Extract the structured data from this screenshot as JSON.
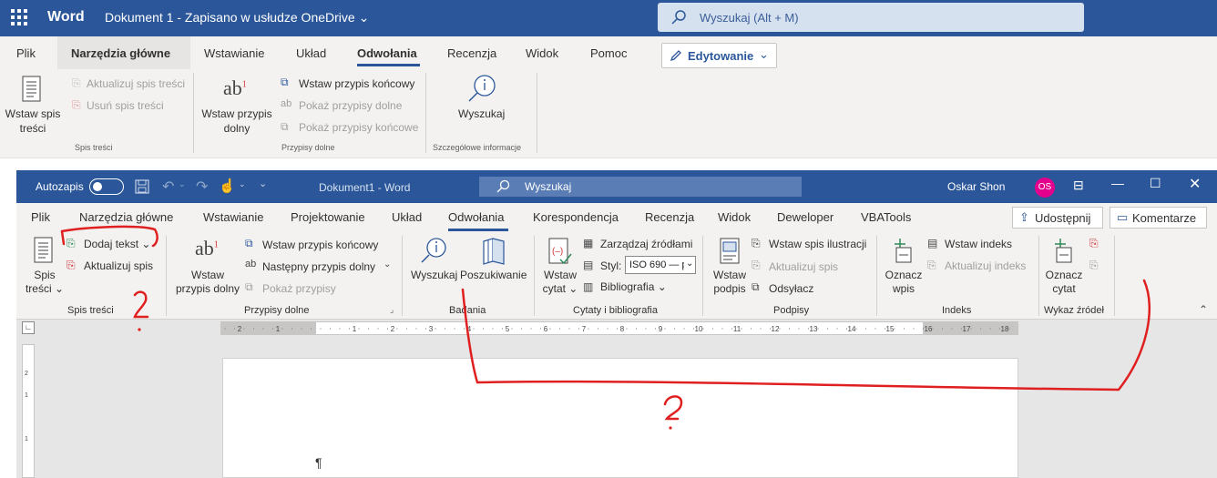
{
  "web": {
    "app_name": "Word",
    "doc_title": "Dokument 1 - Zapisano w usłudze OneDrive",
    "search_placeholder": "Wyszukaj (Alt + M)",
    "tabs": [
      "Plik",
      "Narzędzia główne",
      "Wstawianie",
      "Układ",
      "Odwołania",
      "Recenzja",
      "Widok",
      "Pomoc"
    ],
    "active_tab": "Odwołania",
    "edit_mode": "Edytowanie",
    "ribbon": {
      "toc_group": {
        "title": "Spis treści",
        "insert_toc_line1": "Wstaw spis",
        "insert_toc_line2": "treści",
        "update_toc": "Aktualizuj spis treści",
        "remove_toc": "Usuń spis treści"
      },
      "footnotes_group": {
        "title": "Przypisy dolne",
        "insert_footnote_line1": "Wstaw przypis",
        "insert_footnote_line2": "dolny",
        "insert_endnote": "Wstaw przypis końcowy",
        "show_footnotes": "Pokaż przypisy dolne",
        "show_endnotes": "Pokaż przypisy końcowe"
      },
      "research_group": {
        "title": "Szczegółowe informacje",
        "search": "Wyszukaj"
      }
    }
  },
  "desktop": {
    "autosave_label": "Autozapis",
    "autosave_state": "off",
    "title": "Dokument1 - Word",
    "search_placeholder": "Wyszukaj",
    "user_name": "Oskar Shon",
    "user_initials": "OS",
    "tabs": [
      "Plik",
      "Narzędzia główne",
      "Wstawianie",
      "Projektowanie",
      "Układ",
      "Odwołania",
      "Korespondencja",
      "Recenzja",
      "Widok",
      "Deweloper",
      "VBATools"
    ],
    "active_tab": "Odwołania",
    "share_label": "Udostępnij",
    "comments_label": "Komentarze",
    "ribbon": {
      "toc": {
        "title": "Spis treści",
        "toc_line1": "Spis",
        "toc_line2": "treści",
        "add_text": "Dodaj tekst",
        "update_table": "Aktualizuj spis"
      },
      "footnotes": {
        "title": "Przypisy dolne",
        "insert_line1": "Wstaw",
        "insert_line2": "przypis dolny",
        "insert_endnote": "Wstaw przypis końcowy",
        "next_footnote": "Następny przypis dolny",
        "show_notes": "Pokaż przypisy"
      },
      "research": {
        "title": "Badania",
        "search": "Wyszukaj",
        "researcher": "Poszukiwanie"
      },
      "citations": {
        "title": "Cytaty i bibliografia",
        "insert_line1": "Wstaw",
        "insert_line2": "cytat",
        "manage_sources": "Zarządzaj źródłami",
        "style_label": "Styl:",
        "style_value": "ISO 690 — p",
        "bibliography": "Bibliografia"
      },
      "captions": {
        "title": "Podpisy",
        "insert_line1": "Wstaw",
        "insert_line2": "podpis",
        "insert_tof": "Wstaw spis ilustracji",
        "update_table": "Aktualizuj spis",
        "cross_ref": "Odsyłacz"
      },
      "index": {
        "title": "Indeks",
        "mark_line1": "Oznacz",
        "mark_line2": "wpis",
        "insert_index": "Wstaw indeks",
        "update_index": "Aktualizuj indeks"
      },
      "toa": {
        "title": "Wykaz źródeł",
        "mark_line1": "Oznacz",
        "mark_line2": "cytat"
      }
    },
    "ruler_numbers": [
      "2",
      "1",
      "1",
      "2",
      "3",
      "4",
      "5",
      "6",
      "7",
      "8",
      "9",
      "10",
      "11",
      "12",
      "13",
      "14",
      "15",
      "16",
      "17",
      "18"
    ],
    "vruler_numbers": [
      "2",
      "1",
      "1"
    ],
    "pilcrow": "¶"
  },
  "colors": {
    "brand": "#2b579a",
    "annotation": "#e02020"
  }
}
